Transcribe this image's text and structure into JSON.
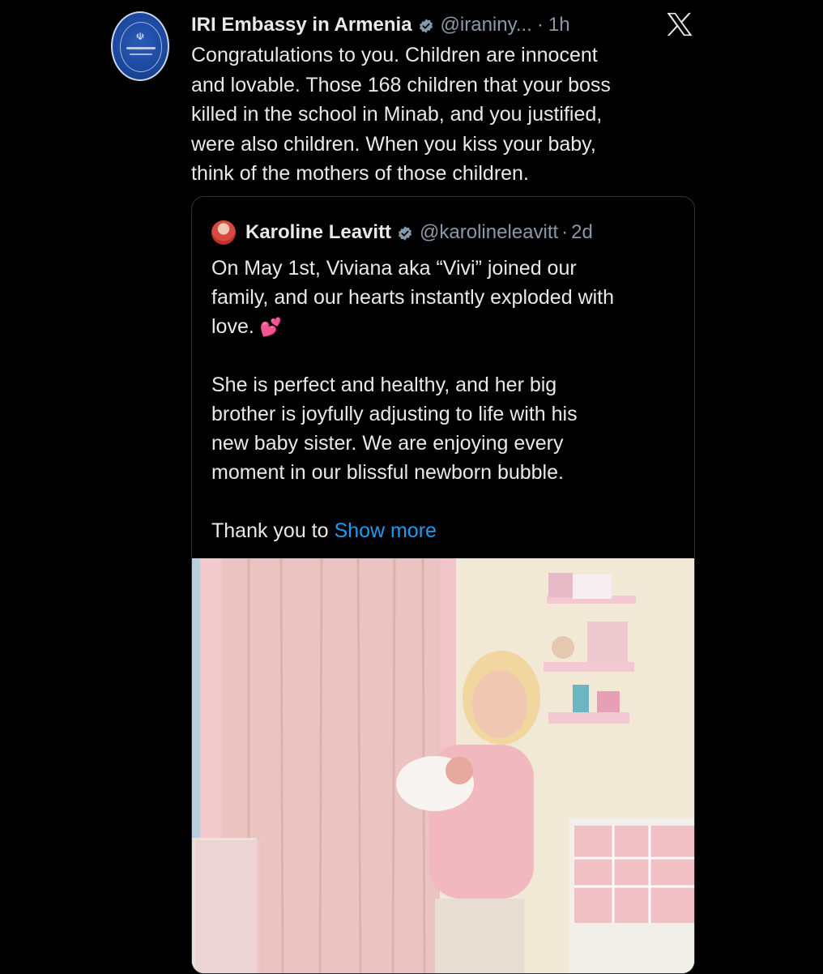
{
  "tweet": {
    "display_name": "IRI Embassy in Armenia",
    "handle": "@iraniny...",
    "separator": "·",
    "time": "1h",
    "verified_icon": "verified-badge-icon",
    "lines": [
      "Congratulations to you. Children are innocent",
      "and lovable. Those 168 children that your boss",
      "killed in the school in Minab, and you justified,",
      "were also children. When you kiss your baby,",
      "think of the mothers of those children."
    ]
  },
  "platform_logo": "x-logo-icon",
  "quoted_tweet": {
    "display_name": "Karoline Leavitt",
    "handle": "@karolineleavitt",
    "separator": "·",
    "time": "2d",
    "lines": [
      "On May 1st, Viviana aka “Vivi” joined our",
      "family, and our hearts instantly exploded with"
    ],
    "line3": "love.",
    "emoji": "💕",
    "lines2": [
      "She is perfect and healthy, and her big",
      "brother is joyfully adjusting to life with his",
      "new baby sister. We are enjoying every",
      "moment in our blissful newborn bubble."
    ],
    "trailing_text": "Thank you to",
    "show_more_label": "Show more",
    "link_color": "#1d9bf0"
  },
  "colors": {
    "background": "#000000",
    "text": "#e7e9ea",
    "secondary_text": "#8b98a5",
    "verified": "#829aab",
    "border": "#2f3336"
  }
}
